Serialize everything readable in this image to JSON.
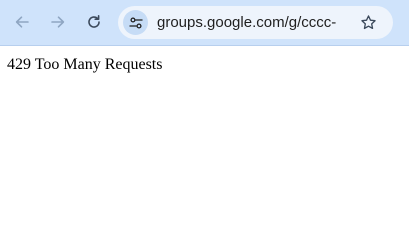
{
  "browser": {
    "url": "groups.google.com/g/cccc-l",
    "icons": {
      "back": "arrow-left-icon",
      "forward": "arrow-right-icon",
      "reload": "reload-icon",
      "site_info": "tune-icon",
      "bookmark": "star-icon"
    },
    "colors": {
      "toolbar": "#cfe3fb",
      "omnibox": "#eef4fc",
      "icon_disabled": "#8fa6c2",
      "icon_active": "#3c4a5c"
    }
  },
  "page": {
    "message": "429 Too Many Requests"
  }
}
